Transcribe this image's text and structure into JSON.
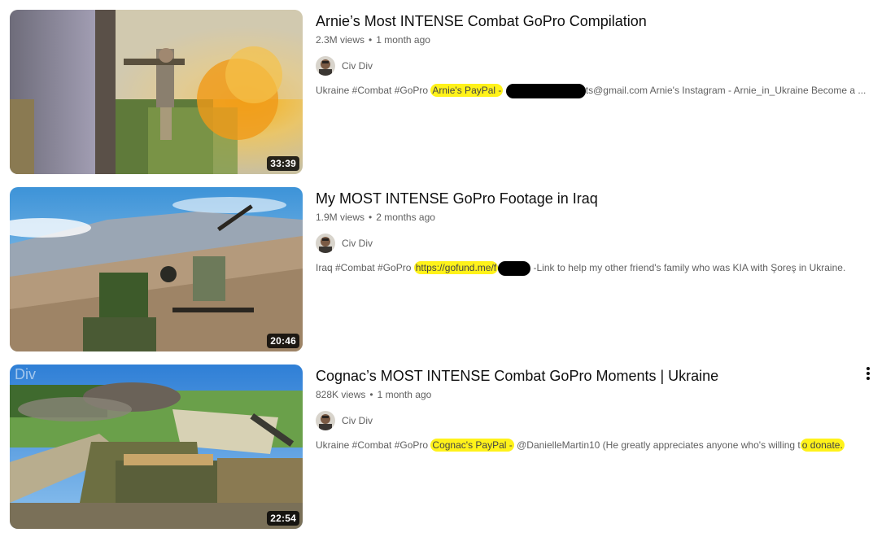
{
  "videos": [
    {
      "title": "Arnie’s Most INTENSE Combat GoPro Compilation",
      "views": "2.3M views",
      "age": "1 month ago",
      "channel": "Civ Div",
      "duration": "33:39",
      "desc_plain1": "Ukraine #Combat #GoPro",
      "desc_hl1": "Arnie's PayPal -",
      "desc_plain2": "ts@gmail.com Arnie's Instagram - Arnie_in_Ukraine Become a ..."
    },
    {
      "title": "My MOST INTENSE GoPro Footage in Iraq",
      "views": "1.9M views",
      "age": "2 months ago",
      "channel": "Civ Div",
      "duration": "20:46",
      "desc_plain1": "Iraq #Combat #GoPro",
      "desc_hl1": "https://gofund.me/f",
      "desc_plain2": "-Link to help my other friend's family who was KIA with Şoreş in Ukraine."
    },
    {
      "title": "Cognac’s MOST INTENSE Combat GoPro Moments | Ukraine",
      "views": "828K views",
      "age": "1 month ago",
      "channel": "Civ Div",
      "duration": "22:54",
      "desc_plain1": "Ukraine #Combat #GoPro",
      "desc_hl1": "Cognac's PayPal -",
      "desc_plain2": "@DanielleMartin10 (He greatly appreciates anyone who's willing t",
      "desc_hl2": "o donate.",
      "watermark": "Div"
    }
  ],
  "icons": {
    "more": "vertical-ellipsis-icon"
  }
}
